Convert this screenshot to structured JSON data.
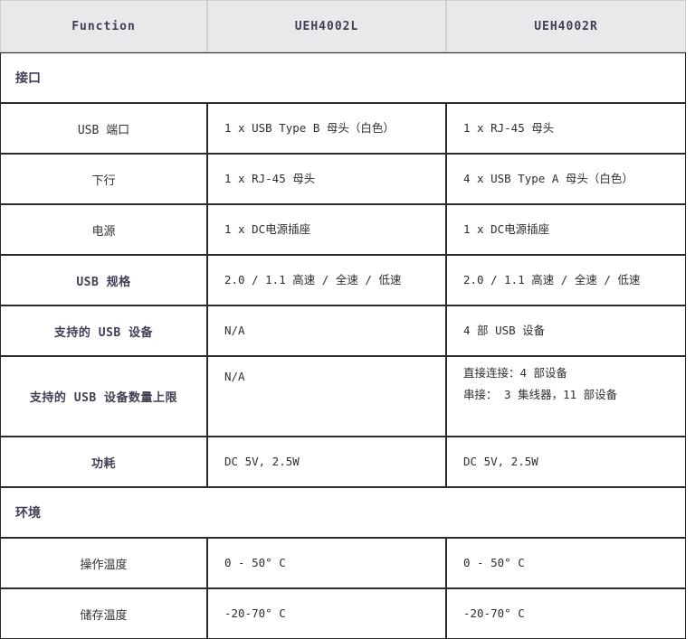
{
  "table": {
    "columns": [
      {
        "key": "function",
        "label": "Function"
      },
      {
        "key": "ueh4002l",
        "label": "UEH4002L"
      },
      {
        "key": "ueh4002r",
        "label": "UEH4002R"
      }
    ],
    "sections": [
      {
        "id": "interface",
        "label": "接口"
      },
      {
        "id": "environment",
        "label": "环境"
      }
    ],
    "rows": {
      "usb_port": {
        "label": "USB 端口",
        "left": "1 x USB Type B 母头（白色）",
        "right": "1 x RJ-45 母头"
      },
      "downstream": {
        "label": "下行",
        "left": "1 x RJ-45 母头",
        "right": "4 x USB Type A 母头（白色）"
      },
      "power": {
        "label": "电源",
        "left": "1 x DC电源插座",
        "right": "1 x DC电源插座"
      },
      "usb_spec": {
        "label": "USB 规格",
        "left": "2.0 / 1.1 高速 / 全速 / 低速",
        "right": "2.0 / 1.1 高速 / 全速 / 低速"
      },
      "supported": {
        "label": "支持的 USB 设备",
        "left": "N/A",
        "right": "4 部 USB 设备"
      },
      "max_devices": {
        "label": "支持的 USB 设备数量上限",
        "left": "N/A",
        "right_line1": "直接连接：4 部设备",
        "right_line2": "串接： 3 集线器，11 部设备"
      },
      "consumption": {
        "label": "功耗",
        "left": "DC 5V, 2.5W",
        "right": "DC 5V, 2.5W"
      },
      "op_temp": {
        "label": "操作温度",
        "left": "0 - 50° C",
        "right": "0 - 50° C"
      },
      "storage_temp": {
        "label": "储存温度",
        "left": "-20-70° C",
        "right": "-20-70° C"
      }
    }
  },
  "colors": {
    "header_bg": "#e9e9eb",
    "header_border": "#cfcfd2",
    "cell_border": "#2b2b2b",
    "label_text": "#3f3f55",
    "value_text": "#2f2f2f",
    "page_bg": "#ffffff"
  }
}
